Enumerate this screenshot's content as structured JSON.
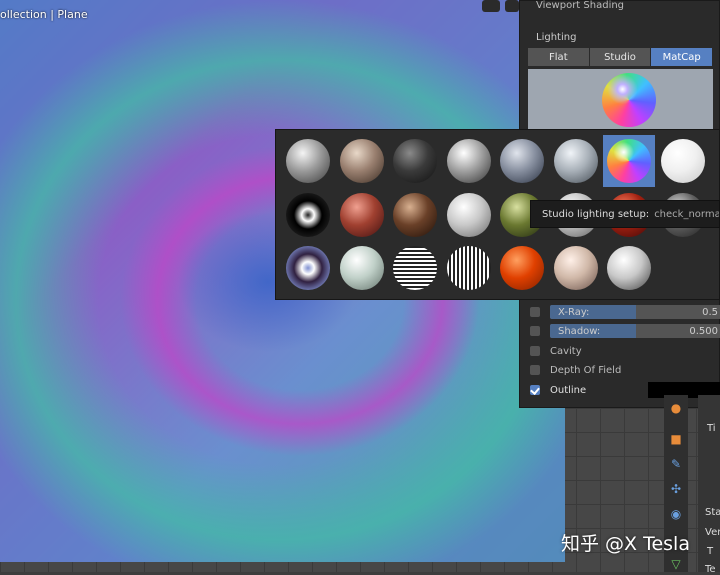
{
  "viewport": {
    "title": "ollection | Plane"
  },
  "shading": {
    "title": "Viewport Shading",
    "lighting_label": "Lighting",
    "lighting_modes": [
      {
        "label": "Flat",
        "active": false
      },
      {
        "label": "Studio",
        "active": false
      },
      {
        "label": "MatCap",
        "active": true
      }
    ],
    "xray": {
      "label": "X-Ray:",
      "value": "0.5",
      "fraction": 0.5
    },
    "shadow": {
      "label": "Shadow:",
      "value": "0.500",
      "fraction": 0.5
    },
    "cavity": {
      "label": "Cavity",
      "checked": false
    },
    "dof": {
      "label": "Depth Of Field",
      "checked": false
    },
    "outline": {
      "label": "Outline",
      "checked": true,
      "color": "#000000"
    }
  },
  "matcaps": [
    {
      "name": "ceramic-lightbulb",
      "colors": [
        "#f4f4f4",
        "#9a9a9a",
        "#3a3a3a"
      ]
    },
    {
      "name": "clay-brown",
      "colors": [
        "#e8d8c8",
        "#9a8070",
        "#3a2c22"
      ]
    },
    {
      "name": "clay-studio",
      "colors": [
        "#8a8a8a",
        "#3a3a3a",
        "#101010"
      ]
    },
    {
      "name": "metal-carpaint",
      "colors": [
        "#ffffff",
        "#a0a0a0",
        "#303030"
      ]
    },
    {
      "name": "metal-anisotropic",
      "colors": [
        "#e0e4ec",
        "#8890a0",
        "#283040"
      ]
    },
    {
      "name": "metal-shiny",
      "colors": [
        "#f0f4f8",
        "#a8b0b8",
        "#404850"
      ]
    },
    {
      "name": "check-normal-y",
      "colors": [
        "#ff40a0",
        "#40c0ff",
        "#6060ff"
      ],
      "selected": true
    },
    {
      "name": "white-glow",
      "colors": [
        "#ffffff",
        "#f0f0f0",
        "#c8c8c8"
      ]
    },
    {
      "name": "reflection-check",
      "colors": [
        "#ffffff",
        "#202020",
        "#000000"
      ]
    },
    {
      "name": "jade-red",
      "colors": [
        "#f0a090",
        "#a04030",
        "#401010"
      ]
    },
    {
      "name": "skin-dark",
      "colors": [
        "#d8b090",
        "#6a4028",
        "#201008"
      ]
    },
    {
      "name": "pearl-white",
      "colors": [
        "#ffffff",
        "#c8c8c8",
        "#686868"
      ]
    },
    {
      "name": "toon-green",
      "colors": [
        "#d8e0a0",
        "#6a7830",
        "#202810"
      ]
    },
    {
      "name": "metal-silver",
      "colors": [
        "#ffffff",
        "#c0c0c0",
        "#606060"
      ]
    },
    {
      "name": "resin-red",
      "colors": [
        "#ff8060",
        "#a02010",
        "#400808"
      ]
    },
    {
      "name": "glass-grey",
      "colors": [
        "#e0e0e0",
        "#606060",
        "#202020"
      ]
    },
    {
      "name": "dichroic",
      "colors": [
        "#ffffff",
        "#8090d0",
        "#302040"
      ]
    },
    {
      "name": "pearl-green",
      "colors": [
        "#ffffff",
        "#c0d0c8",
        "#607068"
      ]
    },
    {
      "name": "stripes-horizontal",
      "colors": [
        "#ffffff",
        "#202020",
        "#ffffff"
      ]
    },
    {
      "name": "stripes-vertical",
      "colors": [
        "#ffffff",
        "#202020",
        "#ffffff"
      ]
    },
    {
      "name": "toon-orange",
      "colors": [
        "#ffa060",
        "#e04000",
        "#802000"
      ]
    },
    {
      "name": "skin-light",
      "colors": [
        "#fff0e8",
        "#d0b8a8",
        "#685048"
      ]
    },
    {
      "name": "cel-grey",
      "colors": [
        "#ffffff",
        "#c8c8c8",
        "#404040"
      ]
    }
  ],
  "tooltip": {
    "label": "Studio lighting setup:",
    "value": "check_normal+y.e"
  },
  "properties": {
    "ti": "Ti",
    "sta": "Sta",
    "ver": "Ver",
    "t": "T",
    "te": "Te"
  },
  "watermark": "知乎 @X Tesla"
}
